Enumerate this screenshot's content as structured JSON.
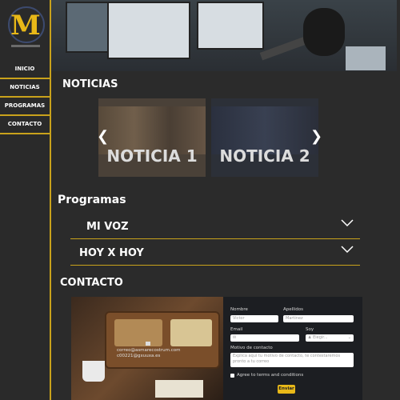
{
  "logo": {
    "letter": "M"
  },
  "nav": [
    {
      "label": "INICIO"
    },
    {
      "label": "NOTICIAS"
    },
    {
      "label": "PROGRAMAS"
    },
    {
      "label": "CONTACTO"
    }
  ],
  "sections": {
    "news_title": "NOTICIAS",
    "programs_title": "Programas",
    "contact_title": "CONTACTO"
  },
  "news": [
    {
      "label": "NOTICIA 1"
    },
    {
      "label": "NOTICIA 2"
    }
  ],
  "carousel": {
    "prev_icon": "chevron-left-icon",
    "next_icon": "chevron-right-icon"
  },
  "programs": [
    {
      "title": "MI VOZ"
    },
    {
      "title": "HOY X HOY"
    }
  ],
  "contact": {
    "email": "correo@asmarecostrum.com",
    "email2": "c00221@gxuuxa.es",
    "form": {
      "nombre_label": "Nombre",
      "nombre_placeholder": "Victor",
      "apellidos_label": "Apellidos",
      "apellidos_placeholder": "Martinez",
      "email_label": "Email",
      "soy_label": "Soy",
      "soy_value": "Elegir...",
      "motivo_label": "Motivo de contacto",
      "motivo_placeholder": "Explica aquí tu motivo de contacto, te contestaremos pronto a tu correo",
      "terms_label": "Agree to terms and conditions",
      "submit_label": "Enviar"
    }
  },
  "colors": {
    "accent": "#c9a21b",
    "logo": "#e8b818",
    "background": "#2b2b2b"
  }
}
